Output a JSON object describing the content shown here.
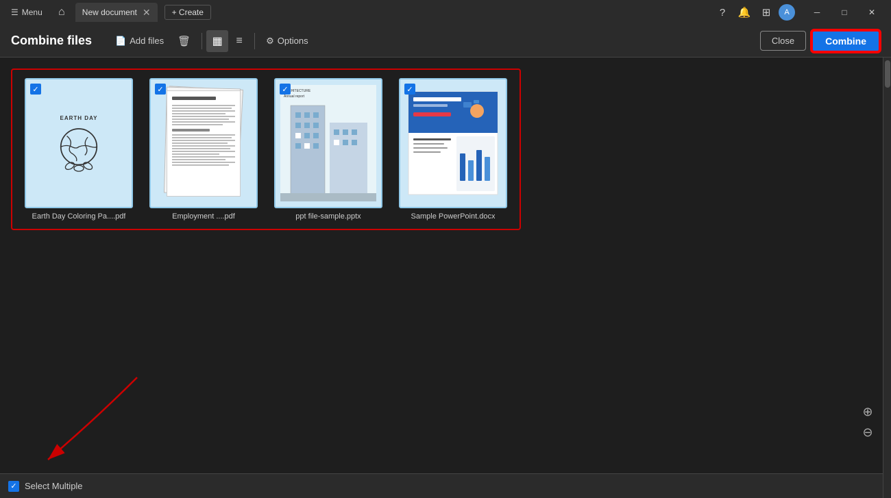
{
  "titlebar": {
    "menu_label": "Menu",
    "tab_label": "New document",
    "create_label": "+ Create"
  },
  "toolbar": {
    "title": "Combine files",
    "add_files_label": "Add files",
    "delete_label": "",
    "options_label": "Options",
    "close_label": "Close",
    "combine_label": "Combine"
  },
  "files": [
    {
      "name": "Earth Day Coloring Pa....pdf",
      "type": "earth",
      "checked": true
    },
    {
      "name": "Employment ....pdf",
      "type": "document",
      "checked": true
    },
    {
      "name": "ppt file-sample.pptx",
      "type": "building",
      "checked": true
    },
    {
      "name": "Sample PowerPoint.docx",
      "type": "ppt",
      "checked": true
    }
  ],
  "bottom": {
    "select_multiple_label": "Select Multiple"
  },
  "icons": {
    "menu": "☰",
    "home": "⌂",
    "close_tab": "✕",
    "trash": "🗑",
    "grid_view": "▦",
    "list_view": "≡",
    "settings": "⚙",
    "add_files": "📄",
    "help": "?",
    "bell": "🔔",
    "apps": "⊞",
    "minimize": "─",
    "maximize": "□",
    "close_win": "✕",
    "zoom_in": "⊕",
    "zoom_out": "⊖",
    "checkmark": "✓"
  }
}
